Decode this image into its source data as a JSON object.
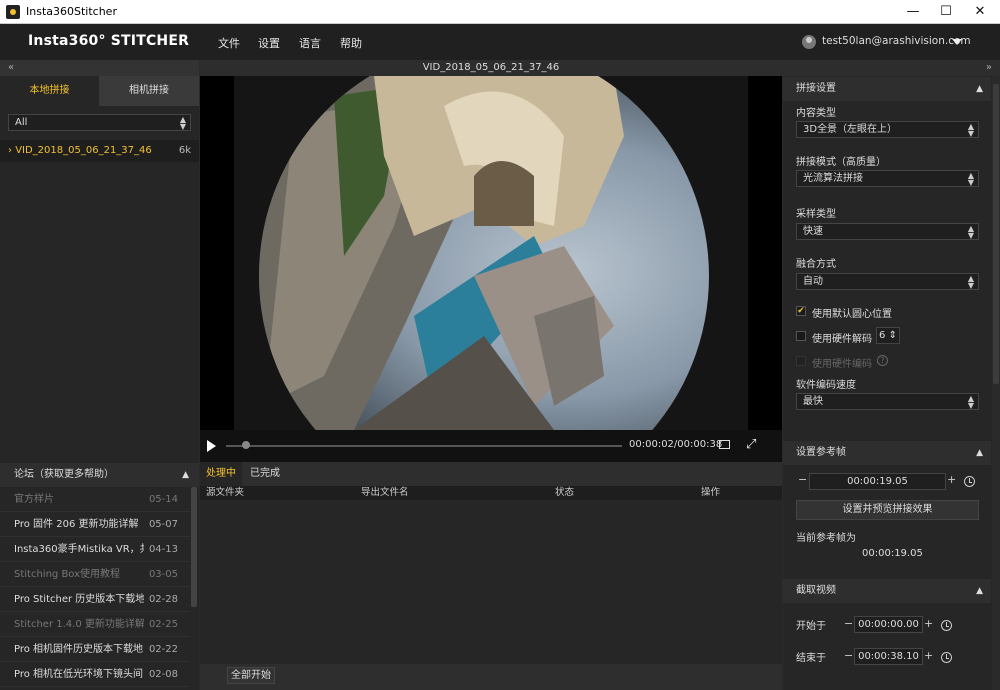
{
  "window": {
    "title": "Insta360Stitcher",
    "minimize": "—",
    "maximize": "☐",
    "close": "✕"
  },
  "header": {
    "logo": "Insta360° STITCHER",
    "menu": [
      "文件",
      "设置",
      "语言",
      "帮助"
    ],
    "user_email": "test50lan@arashivision.com"
  },
  "left": {
    "collapse": "«",
    "tabs": [
      "本地拼接",
      "相机拼接"
    ],
    "filter": "All",
    "file": {
      "name": "VID_2018_05_06_21_37_46",
      "size": "6k"
    },
    "forum_title": "论坛（获取更多帮助）",
    "news": [
      {
        "title": "官方样片",
        "date": "05-14",
        "dim": true
      },
      {
        "title": "Pro 固件 206 更新功能详解",
        "date": "05-07",
        "dim": false
      },
      {
        "title": "Insta360豪手Mistika VR，共...",
        "date": "04-13",
        "dim": false
      },
      {
        "title": "Stitching Box使用教程",
        "date": "03-05",
        "dim": true
      },
      {
        "title": "Pro Stitcher 历史版本下载地...",
        "date": "02-28",
        "dim": false
      },
      {
        "title": "Stitcher 1.4.0 更新功能详解",
        "date": "02-25",
        "dim": true
      },
      {
        "title": "Pro 相机固件历史版本下载地...",
        "date": "02-22",
        "dim": false
      },
      {
        "title": "Pro 相机在低光环境下镜头间...",
        "date": "02-08",
        "dim": false
      }
    ]
  },
  "center": {
    "video_title": "VID_2018_05_06_21_37_46",
    "time": "00:00:02/00:00:38",
    "progress": 0.05,
    "task_tabs": [
      "处理中",
      "已完成"
    ],
    "columns": [
      "源文件夹",
      "导出文件名",
      "状态",
      "操作"
    ],
    "start_all": "全部开始"
  },
  "right": {
    "collapse": "»",
    "stitch_section": "拼接设置",
    "content_type_label": "内容类型",
    "content_type": "3D全景（左眼在上）",
    "stitch_mode_label": "拼接模式（高质量）",
    "stitch_mode": "光流算法拼接",
    "sampling_label": "采样类型",
    "sampling": "快速",
    "blend_label": "融合方式",
    "blend": "自动",
    "default_center": "使用默认圆心位置",
    "hw_decode": "使用硬件解码",
    "hw_decode_count": "6",
    "hw_encode": "使用硬件编码",
    "help_glyph": "?",
    "encode_speed_label": "软件编码速度",
    "encode_speed": "最快",
    "ref_section": "设置参考帧",
    "ref_time": "00:00:19.05",
    "preview_button": "设置并预览拼接效果",
    "current_ref_label": "当前参考帧为",
    "current_ref": "00:00:19.05",
    "trim_section": "截取视频",
    "start_label": "开始于",
    "start_time": "00:00:00.00",
    "end_label": "结束于",
    "end_time": "00:00:38.10",
    "minus": "−",
    "plus": "+"
  },
  "colors": {
    "accent": "#f2c12e",
    "bg": "#262626",
    "header": "#202020"
  }
}
